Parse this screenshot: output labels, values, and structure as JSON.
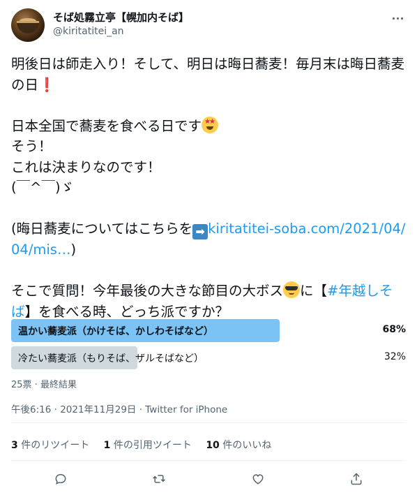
{
  "header": {
    "display_name": "そば処霧立亭【幌加内そば】",
    "handle": "@kiritatitei_an"
  },
  "tweet": {
    "line1": "明後日は師走入り！そして、明日は晦日蕎麦！毎月末は晦日蕎麦の日",
    "exclaim": "❗",
    "line2": "日本全国で蕎麦を食べる日です",
    "line3": "そう！",
    "line4": "これは決まりなのです！",
    "line5": "(￣^￣)ゞ",
    "line6_pre": "(晦日蕎麦についてはこちらを",
    "arrow": "➡",
    "link": "kiritatitei-soba.com/2021/04/04/mis…",
    "line6_post": ")",
    "line7_pre": "そこで質問！今年最後の大きな節目の大ボス",
    "line7_mid": "に【",
    "hashtag": "#年越しそば",
    "line7_post": "】を食べる時、どっち派ですか？"
  },
  "poll": {
    "options": [
      {
        "label": "温かい蕎麦派（かけそば、かしわそばなど）",
        "percent": "68%",
        "fraction": 0.68,
        "winner": true
      },
      {
        "label": "冷たい蕎麦派（もりそば、ザルそばなど）",
        "percent": "32%",
        "fraction": 0.32,
        "winner": false
      }
    ],
    "meta": "25票 · 最終結果"
  },
  "timestamp": "午後6:16 · 2021年11月29日 · Twitter for iPhone",
  "stats": {
    "retweets_count": "3",
    "retweets_label": " 件のリツイート",
    "quotes_count": "1",
    "quotes_label": " 件の引用ツイート",
    "likes_count": "10",
    "likes_label": " 件のいいね"
  },
  "actions": [
    "reply-icon",
    "retweet-icon",
    "like-icon",
    "share-icon"
  ],
  "colors": {
    "accent": "#1d9bf0",
    "poll_winner": "#7cc3f5",
    "poll_other": "#cfd9de",
    "muted": "#536471"
  }
}
